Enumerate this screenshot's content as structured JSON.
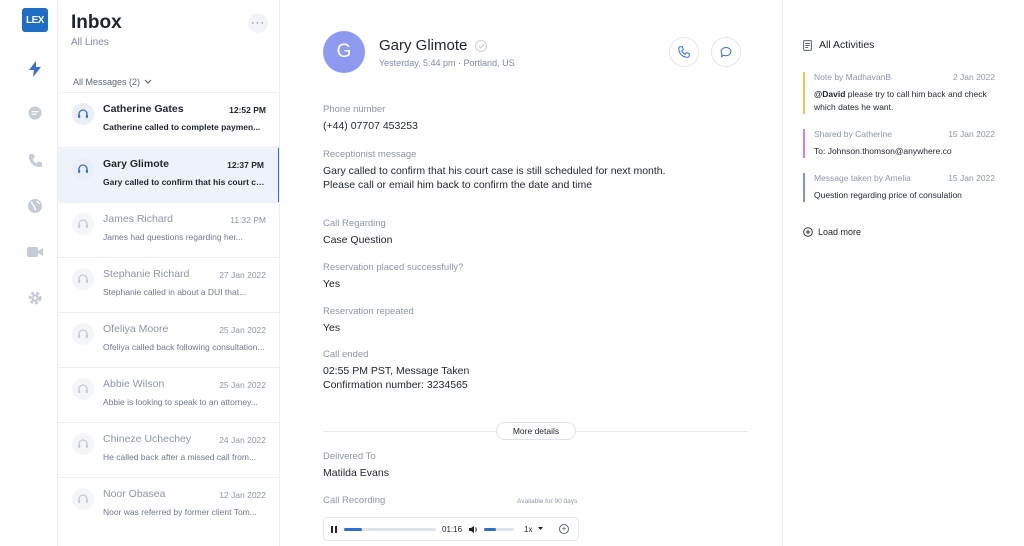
{
  "rail": {
    "logo": "LEX",
    "icons": [
      "bolt-icon",
      "chat-icon",
      "phone-icon",
      "globe-icon",
      "video-icon",
      "gear-icon"
    ]
  },
  "inbox": {
    "title": "Inbox",
    "subtitle": "All Lines",
    "more": "···",
    "filter": "All Messages (2)",
    "messages": [
      {
        "name": "Catherine Gates",
        "time": "12:52 PM",
        "preview": "Catherine called to complete paymen..."
      },
      {
        "name": "Gary Glimote",
        "time": "12:37 PM",
        "preview": "Gary called to confirm that his court case..."
      },
      {
        "name": "James Richard",
        "time": "11:32 PM",
        "preview": "James had questions regarding her..."
      },
      {
        "name": "Stephanie Richard",
        "time": "27 Jan 2022",
        "preview": "Stephanie called in about a DUI that..."
      },
      {
        "name": "Ofeliya Moore",
        "time": "25 Jan 2022",
        "preview": "Ofeliya called back following consultation..."
      },
      {
        "name": "Abbie Wilson",
        "time": "25 Jan 2022",
        "preview": "Abbie is looking to speak to an attorney..."
      },
      {
        "name": "Chineze Uchechey",
        "time": "24 Jan 2022",
        "preview": "He called back after a missed call from..."
      },
      {
        "name": "Noor Obasea",
        "time": "12 Jan 2022",
        "preview": "Noor was referred by former client Tom..."
      }
    ]
  },
  "detail": {
    "avatar_initial": "G",
    "name": "Gary Glimote",
    "meta": "Yesterday, 5:44 pm · Portland, US",
    "phone_label": "Phone number",
    "phone_value": "(+44) 07707 453253",
    "receptionist_label": "Receptionist message",
    "receptionist_line1": "Gary called to confirm that his court case is still scheduled for next month.",
    "receptionist_line2": "Please call or email him back to confirm the date and time",
    "regarding_label": "Call Regarding",
    "regarding_value": "Case Question",
    "reservation_label": "Reservation placed successfully?",
    "reservation_value": "Yes",
    "repeated_label": "Reservation repeated",
    "repeated_value": "Yes",
    "ended_label": "Call ended",
    "ended_line1": "02:55 PM PST, Message Taken",
    "ended_line2": "Confirmation number: 3234565",
    "more_details": "More details",
    "delivered_label": "Delivered To",
    "delivered_value": "Matilda Evans",
    "recording_label": "Call Recording",
    "availability": "Available for 90 days",
    "player": {
      "time": "01:16",
      "speed": "1x",
      "progress": 0.2,
      "volume": 0.4
    }
  },
  "activities": {
    "title": "All Activities",
    "items": [
      {
        "author": "Note by MadhavanB",
        "date": "2 Jan 2022",
        "mention": "@David",
        "body": " please try to call him back and check which dates he want.",
        "color": "#f2c14e"
      },
      {
        "author": "Shared by Catherine",
        "date": "15 Jan 2022",
        "body": "To: Johnson.thomson@anywhere.co",
        "color": "#e07bd2"
      },
      {
        "author": "Message taken by Amelia",
        "date": "15 Jan 2022",
        "body": "Question regarding price of consulation",
        "color": "#7e8ff0"
      }
    ],
    "load_more": "Load more"
  }
}
